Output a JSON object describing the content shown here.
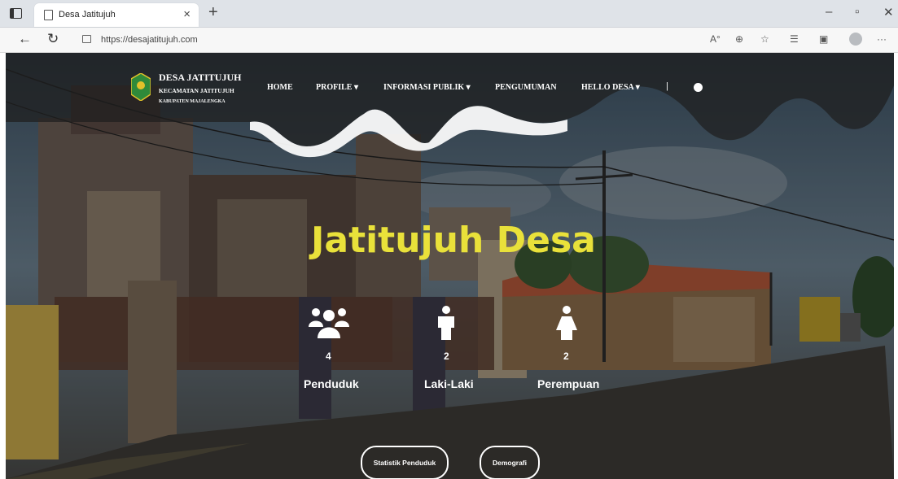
{
  "browser": {
    "tab_title": "Desa Jatitujuh",
    "url": "https://desajatitujuh.com"
  },
  "site": {
    "brand_name": "DESA JATITUJUH",
    "brand_sub1": "KECAMATAN JATITUJUH",
    "brand_sub2": "KABUPATEN MAJALENGKA",
    "nav": {
      "home": "HOME",
      "profile": "PROFILE ▾",
      "informasi": "INFORMASI PUBLIK ▾",
      "pengumuman": "PENGUMUMAN",
      "hello": "HELLO DESA ▾",
      "sep": "|"
    },
    "heading": "Jatitujuh Desa",
    "stats": {
      "penduduk": {
        "value": "4",
        "label": "Penduduk"
      },
      "laki": {
        "value": "2",
        "label": "Laki-Laki"
      },
      "perempuan": {
        "value": "2",
        "label": "Perempuan"
      }
    },
    "buttons": {
      "statistik": "Statistik Penduduk",
      "demografi": "Demografi"
    }
  }
}
